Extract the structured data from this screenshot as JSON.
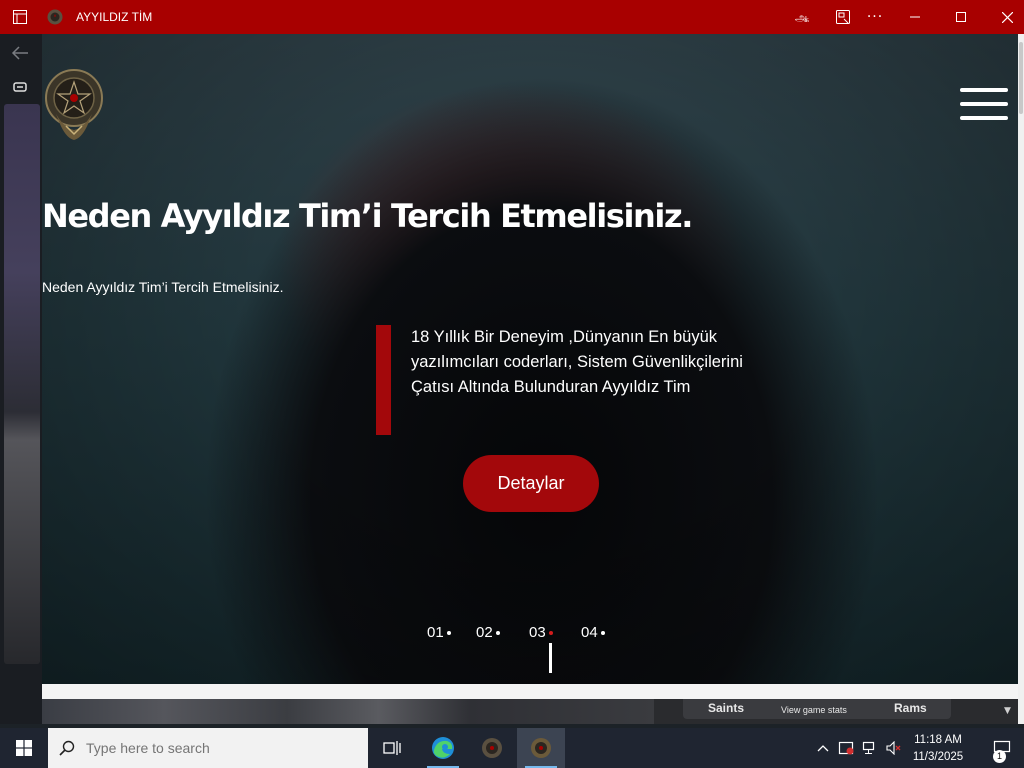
{
  "window": {
    "title": "AYYILDIZ TİM",
    "controls": [
      "read-aloud-icon",
      "app-available-icon",
      "more-icon",
      "minimize-icon",
      "maximize-icon",
      "close-icon"
    ]
  },
  "hero": {
    "title": "Neden  Ayyıldız Tim’i Tercih Etmelisiniz.",
    "subtitle": "Neden Ayyıldız Tim’i Tercih Etmelisiniz.",
    "quote": "18 Yıllık Bir Deneyim ,Dünyanın En büyük yazılımcıları coderları, Sistem Güvenlikçilerini Çatısı Altında Bulunduran Ayyıldız Tim",
    "cta_label": "Detaylar",
    "slides": [
      {
        "label": "01",
        "active": false
      },
      {
        "label": "02",
        "active": false
      },
      {
        "label": "03",
        "active": true
      },
      {
        "label": "04",
        "active": false
      }
    ]
  },
  "background_widget": {
    "team_left": "Saints",
    "stats_link": "View game stats",
    "team_right": "Rams"
  },
  "taskbar": {
    "search_placeholder": "Type here to search",
    "time": "11:18 AM",
    "date": "11/3/2025",
    "notification_count": "1"
  },
  "colors": {
    "brand_red": "#a80000",
    "accent_red": "#a3080b",
    "taskbar": "#1f2531"
  }
}
